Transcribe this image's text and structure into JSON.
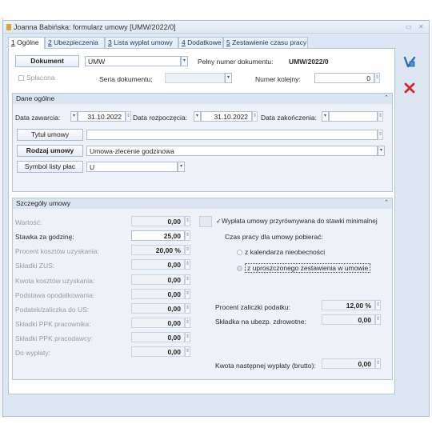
{
  "window": {
    "title": "Joanna Babińska: formularz umowy [UMW/2022/0]",
    "min_glyph": "▭",
    "close_glyph": "✕"
  },
  "tabs": [
    {
      "num": "1",
      "label": " Ogólne"
    },
    {
      "num": "2",
      "label": " Ubezpieczenia"
    },
    {
      "num": "3",
      "label": " Lista wypłat umowy"
    },
    {
      "num": "4",
      "label": " Dodatkowe"
    },
    {
      "num": "5",
      "label": " Zestawienie czasu pracy"
    }
  ],
  "header": {
    "dokument_button": "Dokument",
    "dokument_value": "UMW",
    "pelny_numer_label": "Pełny numer dokumentu:",
    "pelny_numer_value": "UMW/2022/0",
    "splacona_label": "Spłacona",
    "seria_label": "Seria dokumentu:",
    "seria_value": "",
    "numer_kolejny_label": "Numer kolejny:",
    "numer_kolejny_value": "0"
  },
  "dane_ogolne": {
    "title": "Dane ogólne",
    "collapse_glyph": "⌃",
    "data_zawarcia_label": "Data zawarcia:",
    "data_zawarcia_value": "31.10.2022",
    "data_rozpoczecia_label": "Data rozpoczęcia:",
    "data_rozpoczecia_value": "31.10.2022",
    "data_zakonczenia_label": "Data zakończenia:",
    "data_zakonczenia_value": "",
    "tytul_button": "Tytuł umowy",
    "tytul_value": "",
    "rodzaj_button": "Rodzaj umowy",
    "rodzaj_value": "Umowa-zlecenie godzinowa",
    "symbol_button": "Symbol listy płac",
    "symbol_value": "U"
  },
  "szczegoly": {
    "title": "Szczegóły umowy",
    "collapse_glyph": "⌃",
    "rows": [
      {
        "label": "Wartość:",
        "value": "0,00",
        "enabled": false
      },
      {
        "label": "Stawka za godzinę:",
        "value": "25,00",
        "enabled": true
      },
      {
        "label": "Procent kosztów uzyskania:",
        "value": "20,00 %",
        "enabled": false
      },
      {
        "label": "Składki ZUS:",
        "value": "0,00",
        "enabled": false
      },
      {
        "label": "Kwota kosztów uzyskania:",
        "value": "0,00",
        "enabled": false
      },
      {
        "label": "Podstawa opodatkowania:",
        "value": "0,00",
        "enabled": false
      },
      {
        "label": "Podatek/zaliczka do US:",
        "value": "0,00",
        "enabled": false
      },
      {
        "label": "Składki PPK pracownika:",
        "value": "0,00",
        "enabled": false
      },
      {
        "label": "Składki PPK pracodawcy:",
        "value": "0,00",
        "enabled": false
      },
      {
        "label": "Do wypłaty:",
        "value": "0,00",
        "enabled": false
      }
    ],
    "przyrownywana_label": "Wypłata umowy przyrównywana do stawki minimalnej",
    "przyrownywana_checked": true,
    "czas_pracy_label": "Czas pracy dla umowy pobierać:",
    "radio_kalendarz_label": "z kalendarza nieobecności",
    "radio_zestawienie_label": "z uproszczonego zestawienia w umowie",
    "selected_radio": "zestawienie",
    "procent_zaliczki_label": "Procent zaliczki podatku:",
    "procent_zaliczki_value": "12,00 %",
    "skladka_zdrowotne_label": "Składka na ubezp. zdrowotne:",
    "skladka_zdrowotne_value": "0,00",
    "kwota_nastepnej_label": "Kwota następnej wypłaty (brutto):",
    "kwota_nastepnej_value": "0,00"
  },
  "colors": {
    "save_icon": "#2a6fb8",
    "cancel_icon": "#d8262c"
  }
}
